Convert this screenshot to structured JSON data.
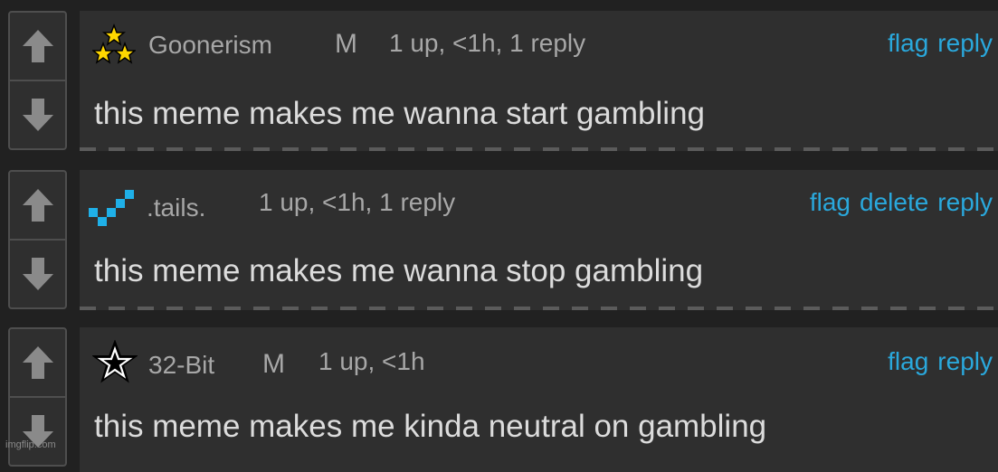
{
  "comments": [
    {
      "username": "Goonerism",
      "mod_badge": "M",
      "meta": "1 up, <1h, 1 reply",
      "actions": [
        "flag",
        "reply"
      ],
      "text": "this meme makes me wanna start gambling",
      "badge_icon": "three-stars-icon"
    },
    {
      "username": ".tails.",
      "mod_badge": "",
      "meta": "1 up, <1h, 1 reply",
      "actions": [
        "flag",
        "delete",
        "reply"
      ],
      "text": "this meme makes me wanna stop gambling",
      "badge_icon": "blue-checkmark-pixels-icon"
    },
    {
      "username": "32-Bit",
      "mod_badge": "M",
      "meta": "1 up, <1h",
      "actions": [
        "flag",
        "reply"
      ],
      "text": "this meme makes me kinda neutral on gambling",
      "badge_icon": "outlined-star-icon"
    }
  ],
  "watermark": "imgflip.com",
  "colors": {
    "link": "#2aa8dc",
    "panel": "#2f2f2f",
    "background": "#212121"
  }
}
